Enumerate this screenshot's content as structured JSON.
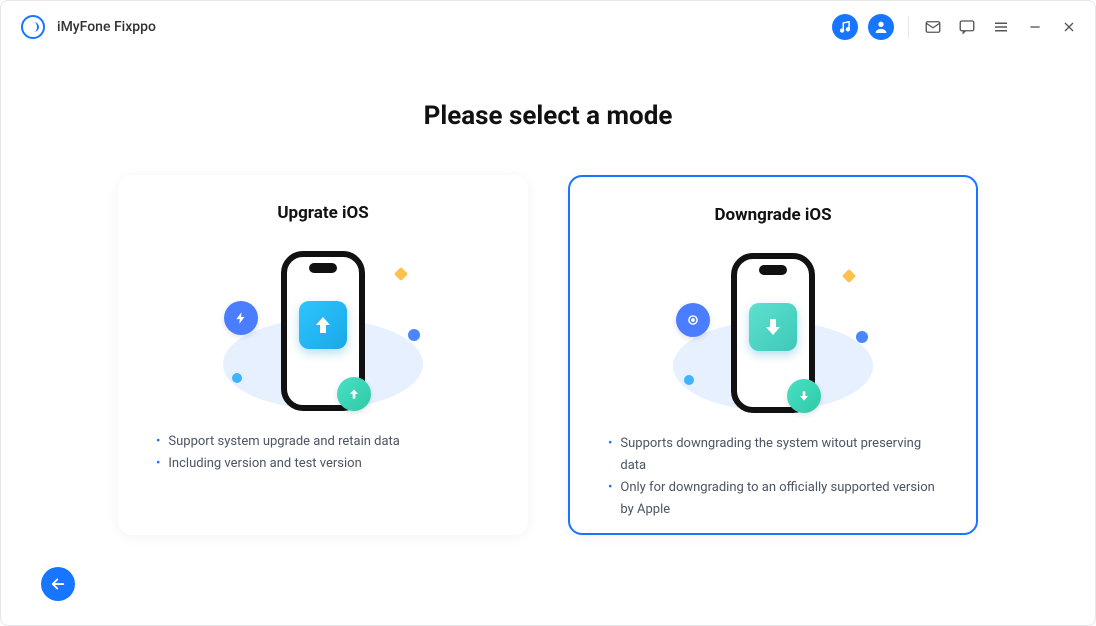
{
  "app": {
    "title": "iMyFone Fixppo"
  },
  "page": {
    "heading": "Please select a mode"
  },
  "cards": {
    "upgrade": {
      "title": "Upgrate iOS",
      "bullets": [
        "Support system upgrade and retain data",
        "Including version and test version"
      ]
    },
    "downgrade": {
      "title": "Downgrade iOS",
      "bullets": [
        "Supports downgrading the system witout preserving data",
        "Only for downgrading to an officially supported version by Apple"
      ]
    }
  },
  "colors": {
    "primary": "#1776ff",
    "upgrade_tile": "linear-gradient(135deg,#2ec5ff,#1aa8e6)",
    "downgrade_tile": "linear-gradient(135deg,#5de0d0,#3ec9b8)"
  }
}
